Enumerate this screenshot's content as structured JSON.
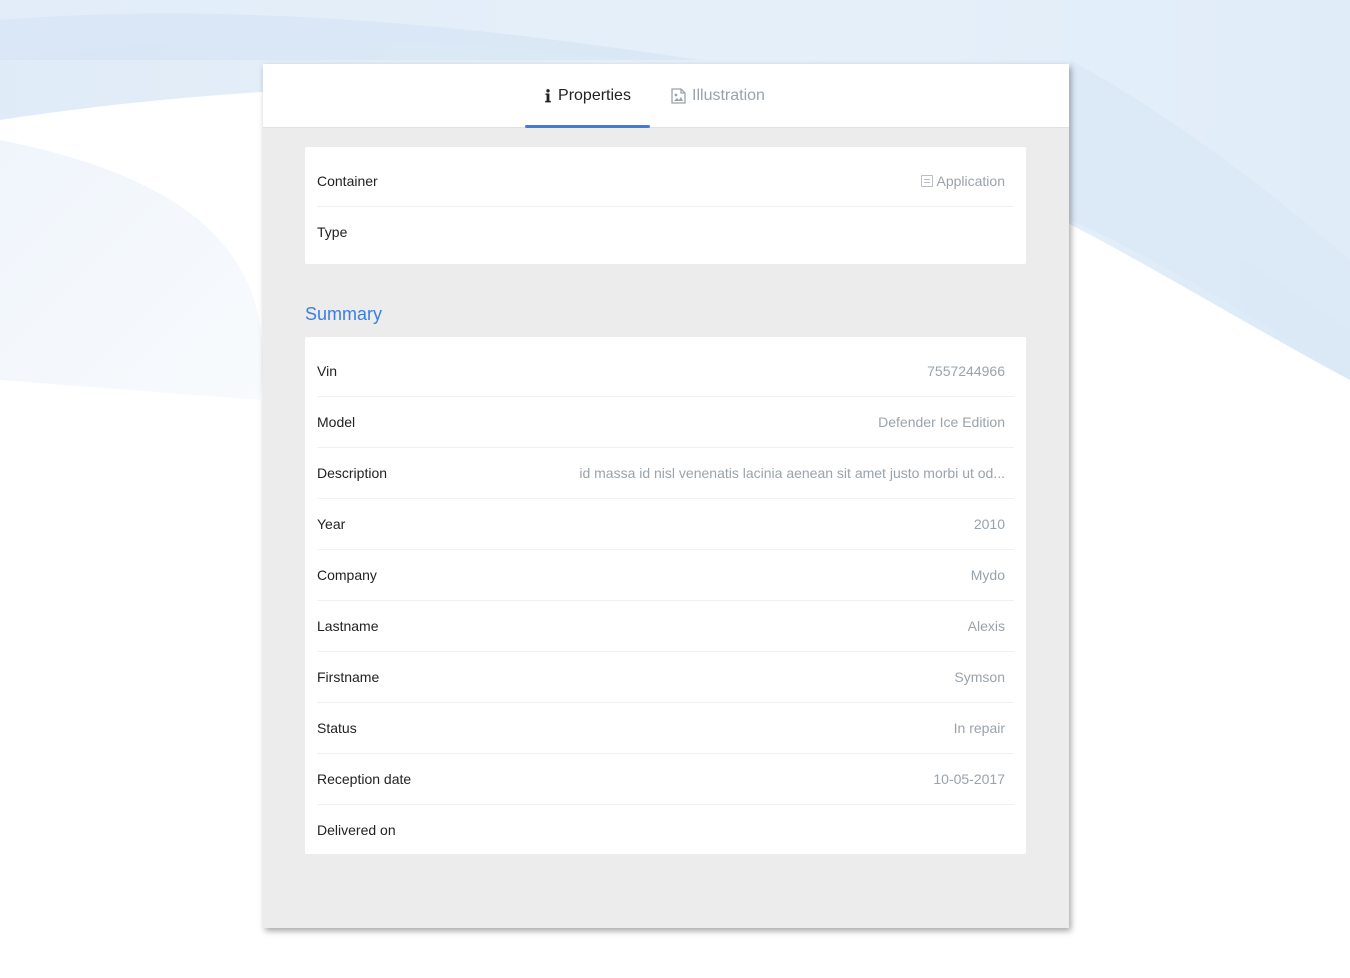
{
  "tabs": {
    "properties": {
      "label": "Properties",
      "icon": "info-icon",
      "active": true
    },
    "illustration": {
      "label": "Illustration",
      "icon": "image-icon",
      "active": false
    }
  },
  "top_card": {
    "container_label": "Container",
    "container_value": "Application",
    "container_icon": "document-icon",
    "type_label": "Type",
    "type_value": ""
  },
  "summary": {
    "title": "Summary",
    "rows": [
      {
        "label": "Vin",
        "value": "7557244966"
      },
      {
        "label": "Model",
        "value": "Defender Ice Edition"
      },
      {
        "label": "Description",
        "value": "id massa id nisl venenatis lacinia aenean sit amet justo morbi ut od..."
      },
      {
        "label": "Year",
        "value": "2010"
      },
      {
        "label": "Company",
        "value": "Mydo"
      },
      {
        "label": "Lastname",
        "value": "Alexis"
      },
      {
        "label": "Firstname",
        "value": "Symson"
      },
      {
        "label": "Status",
        "value": "In repair"
      },
      {
        "label": "Reception date",
        "value": "10-05-2017"
      },
      {
        "label": "Delivered on",
        "value": ""
      }
    ]
  },
  "colors": {
    "accent": "#3a7fe0",
    "panel_bg": "#ececec",
    "value_text": "#9aa3ab",
    "label_text": "#222222"
  }
}
